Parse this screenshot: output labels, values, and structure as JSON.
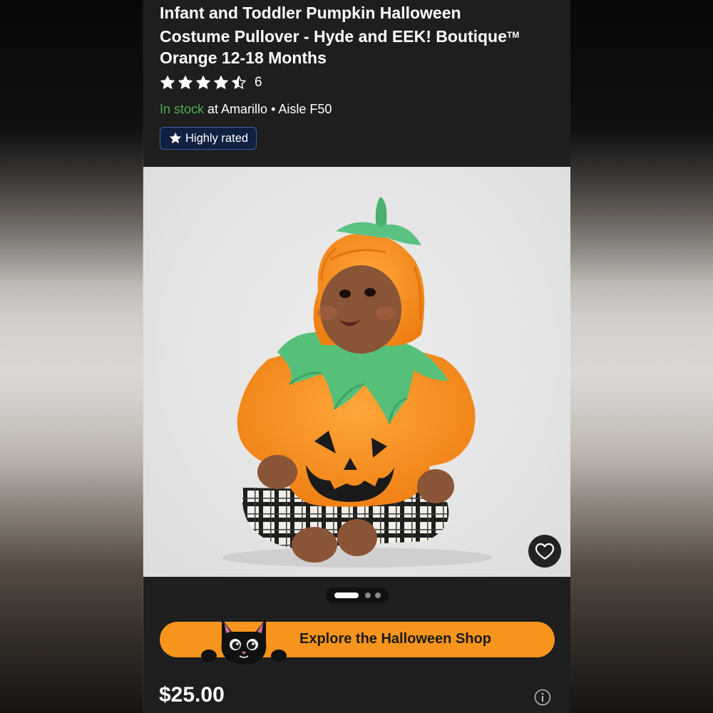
{
  "product": {
    "title_line1": "Infant and Toddler Pumpkin Halloween",
    "title_line2": "Costume Pullover - Hyde and EEK! Boutique",
    "title_tm": "TM",
    "title_line3": "Orange 12-18 Months",
    "rating": {
      "stars": 4.5,
      "max_stars": 5,
      "count": "6"
    },
    "availability": {
      "status": "In stock",
      "location": " at Amarillo • Aisle F50"
    },
    "badge": {
      "label": "Highly rated",
      "icon": "star-icon"
    },
    "image": {
      "subject": "baby-in-pumpkin-costume",
      "favorite_icon": "heart-icon"
    },
    "carousel": {
      "total": 3,
      "active_index": 0
    },
    "price": "$25.00",
    "price_info_icon": "info-icon"
  },
  "promo": {
    "label": "Explore the Halloween Shop",
    "mascot": "black-cat"
  },
  "colors": {
    "background": "#1e1e1e",
    "in_stock_green": "#4caf50",
    "promo_orange": "#f7941d",
    "badge_blue": "#102040"
  }
}
